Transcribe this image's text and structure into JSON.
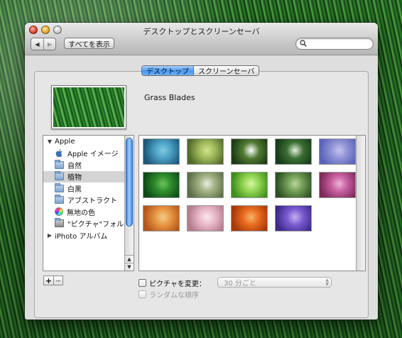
{
  "window": {
    "title": "デスクトップとスクリーンセーバ",
    "show_all_label": "すべてを表示",
    "search": {
      "value": "",
      "placeholder": ""
    }
  },
  "tabs": [
    {
      "label": "デスクトップ",
      "active": true
    },
    {
      "label": "スクリーンセーバ",
      "active": false
    }
  ],
  "selected_picture": {
    "name": "Grass Blades"
  },
  "sources": [
    {
      "label": "Apple",
      "kind": "group",
      "expanded": true
    },
    {
      "label": "Apple イメージ",
      "kind": "apple-icon"
    },
    {
      "label": "自然",
      "kind": "folder-icon"
    },
    {
      "label": "植物",
      "kind": "folder-icon",
      "selected": true
    },
    {
      "label": "白黒",
      "kind": "folder-icon"
    },
    {
      "label": "アブストラクト",
      "kind": "folder-icon"
    },
    {
      "label": "無地の色",
      "kind": "color-wheel-icon"
    },
    {
      "label": "\"ピクチャ\"フォルダ",
      "kind": "pictures-folder-icon"
    },
    {
      "label": "iPhoto アルバム",
      "kind": "group",
      "expanded": false
    }
  ],
  "thumbnails": [
    {
      "name": "agave",
      "colors": [
        "#1d5878",
        "#4aa0c4",
        "#83c9e0"
      ]
    },
    {
      "name": "bamboo",
      "colors": [
        "#516a2a",
        "#9fb85a",
        "#cfe38d"
      ]
    },
    {
      "name": "daisies",
      "colors": [
        "#1f3b15",
        "#4f7a32",
        "#ffffff"
      ]
    },
    {
      "name": "dandelion",
      "colors": [
        "#173c1b",
        "#3b6f33",
        "#e6efe0"
      ]
    },
    {
      "name": "lavender-blur",
      "colors": [
        "#5a63b8",
        "#8f93d6",
        "#c7c4ef"
      ]
    },
    {
      "name": "grass-blades",
      "colors": [
        "#0f4a17",
        "#2d8b2c",
        "#6dc25c"
      ]
    },
    {
      "name": "meadow",
      "colors": [
        "#5d6f4a",
        "#a0b080",
        "#e8ece4"
      ]
    },
    {
      "name": "green-curl",
      "colors": [
        "#3f8d1e",
        "#8fd34f",
        "#d8f8a4"
      ]
    },
    {
      "name": "fern",
      "colors": [
        "#2d4f22",
        "#6f9b53",
        "#b9d59f"
      ]
    },
    {
      "name": "lotus",
      "colors": [
        "#7c2b58",
        "#c75da0",
        "#f0b3d8"
      ]
    },
    {
      "name": "orange-petals",
      "colors": [
        "#b3561c",
        "#e79540",
        "#f3cc8a"
      ]
    },
    {
      "name": "pink-blossom",
      "colors": [
        "#b47b8c",
        "#e8b8c8",
        "#fae8ee"
      ]
    },
    {
      "name": "rose",
      "colors": [
        "#a5390c",
        "#e86a1e",
        "#f7b46a"
      ]
    },
    {
      "name": "purple-aster",
      "colors": [
        "#3d2a8a",
        "#7a5ad0",
        "#c4b2f5"
      ]
    }
  ],
  "options": {
    "change_picture_label": "ピクチャを変更：",
    "interval_value": "30 分ごと",
    "random_order_label": "ランダムな順序"
  },
  "add_label": "+",
  "remove_label": "−",
  "help_label": "?"
}
